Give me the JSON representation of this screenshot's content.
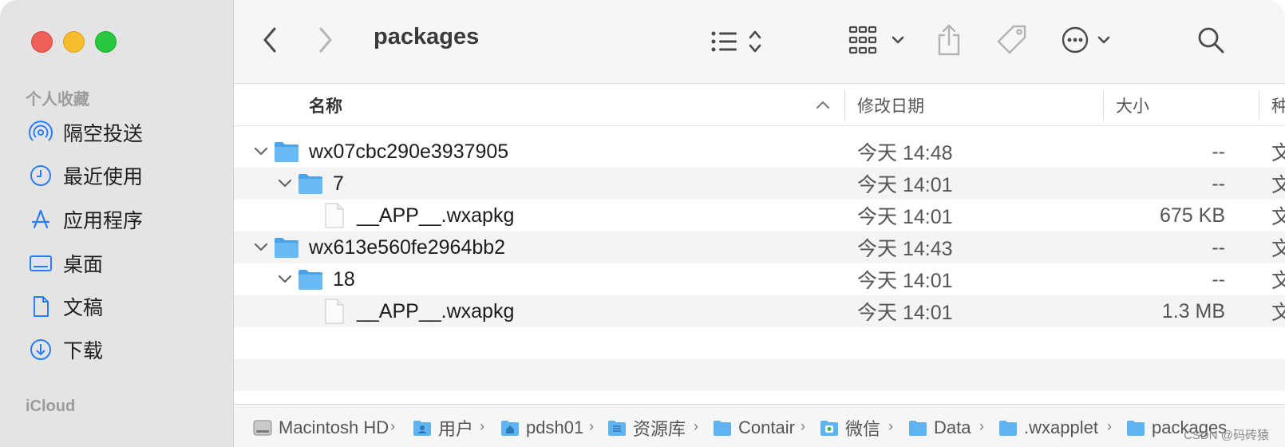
{
  "sidebar": {
    "favorites_heading": "个人收藏",
    "items": [
      {
        "label": "隔空投送",
        "icon": "airdrop-icon"
      },
      {
        "label": "最近使用",
        "icon": "clock-icon"
      },
      {
        "label": "应用程序",
        "icon": "applications-icon"
      },
      {
        "label": "桌面",
        "icon": "desktop-icon"
      },
      {
        "label": "文稿",
        "icon": "document-icon"
      },
      {
        "label": "下载",
        "icon": "download-icon"
      }
    ],
    "icloud_heading": "iCloud"
  },
  "toolbar": {
    "title": "packages"
  },
  "columns": {
    "name": "名称",
    "date": "修改日期",
    "size": "大小",
    "kind": "种"
  },
  "rows": [
    {
      "name": "wx07cbc290e3937905",
      "date": "今天 14:48",
      "size": "--",
      "kind": "文",
      "type": "folder",
      "expanded": true,
      "level": 0
    },
    {
      "name": "7",
      "date": "今天 14:01",
      "size": "--",
      "kind": "文",
      "type": "folder",
      "expanded": true,
      "level": 1
    },
    {
      "name": "__APP__.wxapkg",
      "date": "今天 14:01",
      "size": "675 KB",
      "kind": "文",
      "type": "file",
      "level": 2
    },
    {
      "name": "wx613e560fe2964bb2",
      "date": "今天 14:43",
      "size": "--",
      "kind": "文",
      "type": "folder",
      "expanded": true,
      "level": 0
    },
    {
      "name": "18",
      "date": "今天 14:01",
      "size": "--",
      "kind": "文",
      "type": "folder",
      "expanded": true,
      "level": 1
    },
    {
      "name": "__APP__.wxapkg",
      "date": "今天 14:01",
      "size": "1.3 MB",
      "kind": "文",
      "type": "file",
      "level": 2
    }
  ],
  "pathbar": [
    {
      "label": "Macintosh HD",
      "icon": "hard-drive-icon"
    },
    {
      "label": "用户",
      "icon": "users-folder-icon"
    },
    {
      "label": "pdsh01",
      "icon": "home-folder-icon"
    },
    {
      "label": "资源库",
      "icon": "library-folder-icon"
    },
    {
      "label": "Contair",
      "icon": "folder-icon"
    },
    {
      "label": "微信",
      "icon": "wechat-folder-icon"
    },
    {
      "label": "Data",
      "icon": "folder-icon"
    },
    {
      "label": ".wxapplet",
      "icon": "folder-icon"
    },
    {
      "label": "packages",
      "icon": "folder-icon"
    }
  ],
  "watermark": "CSDN @码砖猿",
  "colors": {
    "folder": "#5eb3f0",
    "accent": "#2a7ef5",
    "sidebar_bg": "#e4e4e4"
  }
}
